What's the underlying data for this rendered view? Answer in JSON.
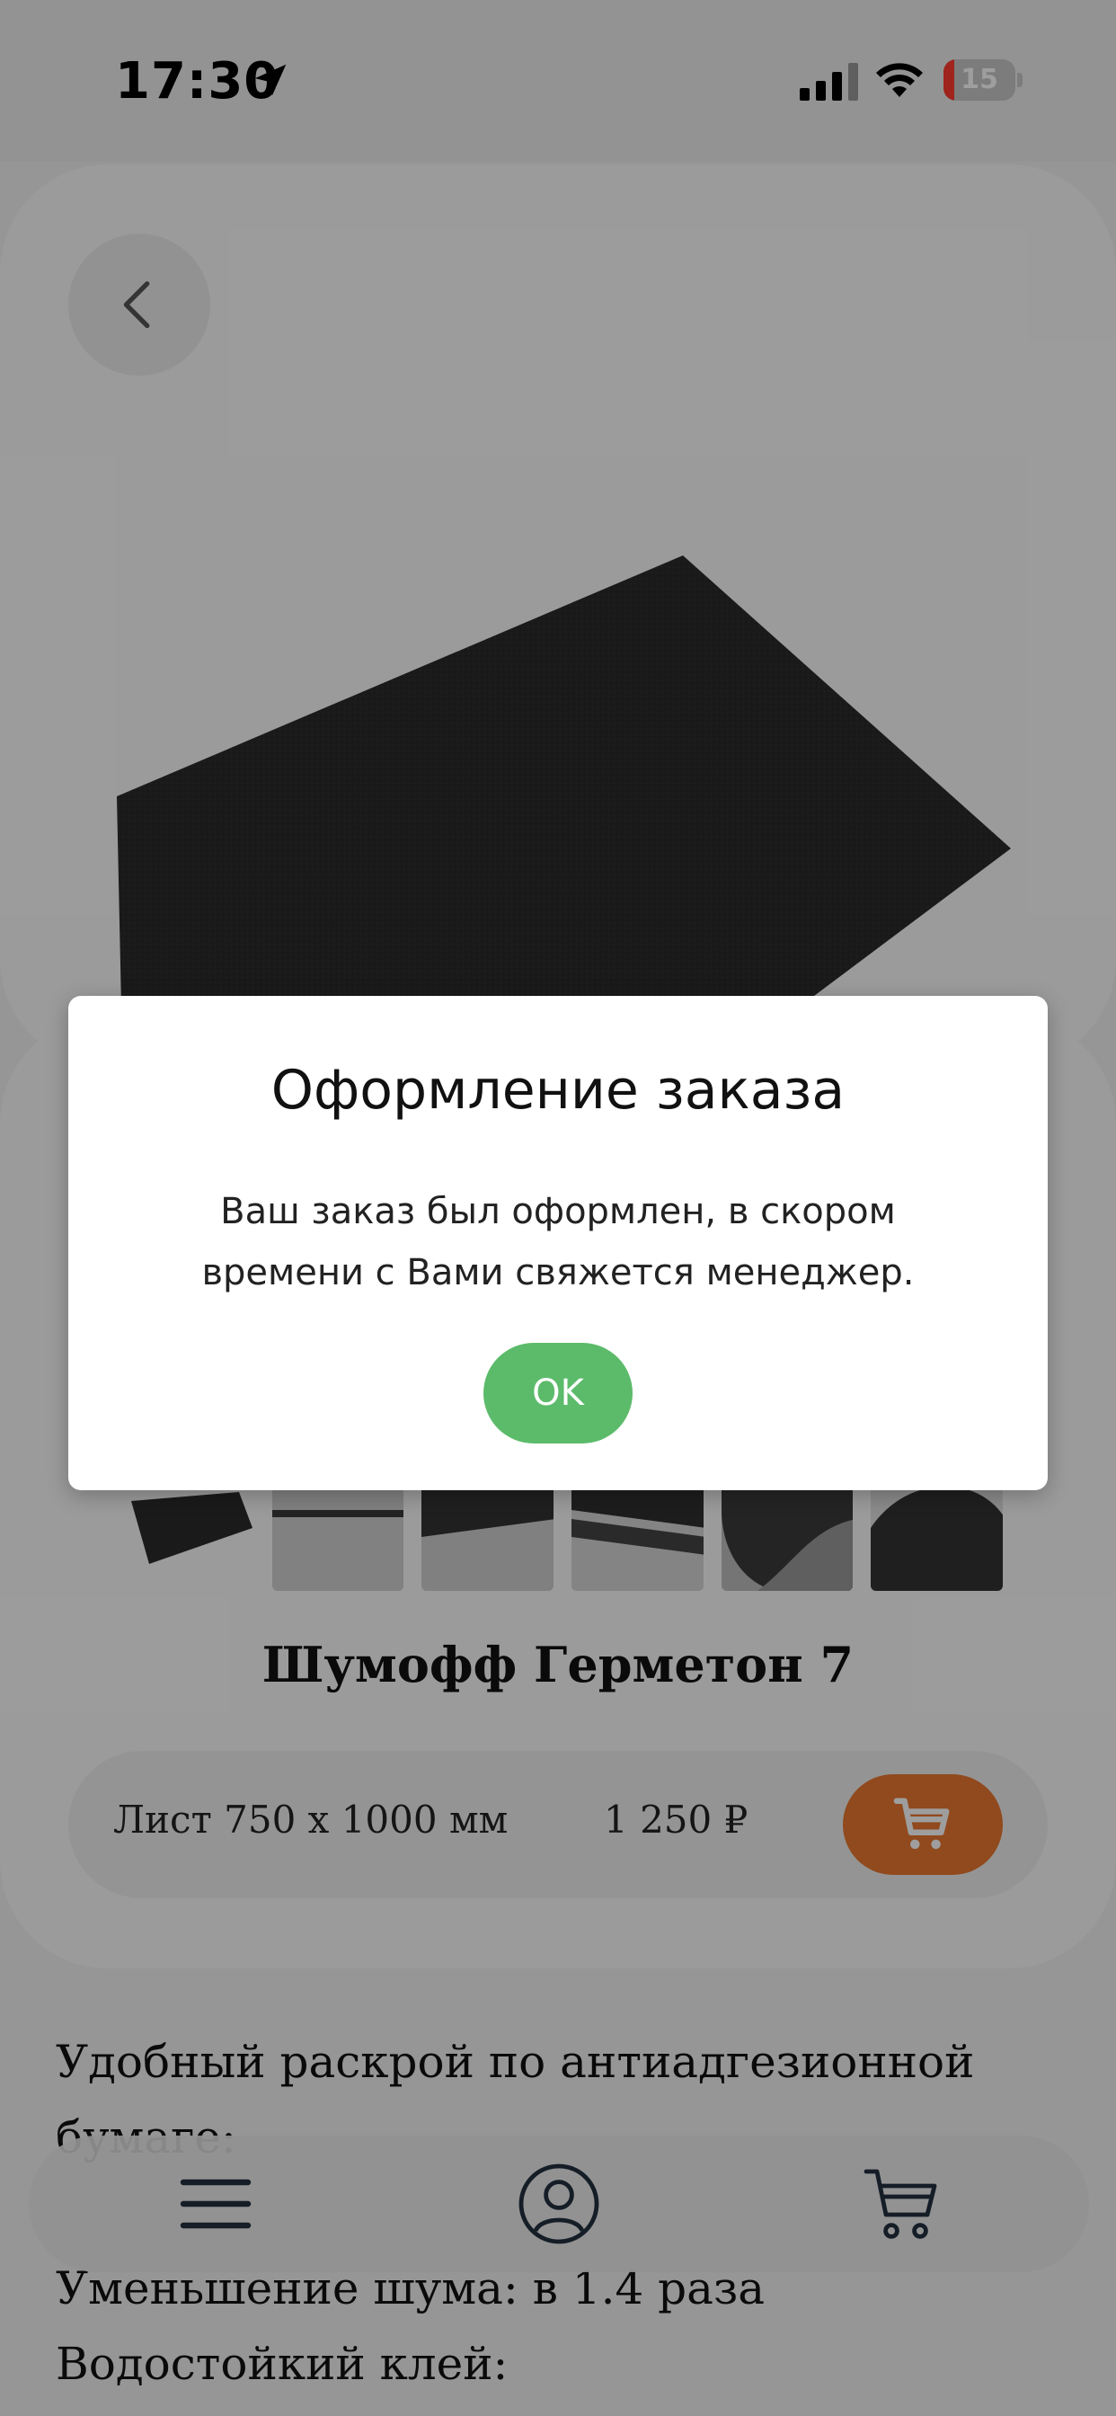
{
  "status_bar": {
    "time": "17:30",
    "battery_level": "15",
    "battery_charging": true
  },
  "product": {
    "title": "Шумофф Герметон 7",
    "image": "black-foam-sheet",
    "thumbnails": [
      "sheet-black",
      "sheet-edge-gray",
      "sheet-corner",
      "sheet-stack",
      "sheet-rolled",
      "sheet-curl"
    ],
    "variant": {
      "name": "Лист 750 x 1000 мм",
      "price": "1 250 ₽"
    },
    "description": [
      "Удобный раскрой по антиадгезионной",
      "бумаге:",
      "Уменьшение шума: в 1.4 раза",
      "Водостойкий клей:"
    ]
  },
  "bottom_nav": {
    "items": [
      "menu-icon",
      "profile-icon",
      "cart-icon"
    ]
  },
  "modal": {
    "title": "Оформление заказа",
    "message_line1": "Ваш заказ был оформлен, в скором",
    "message_line2": "времени с Вами свяжется менеджер.",
    "ok_label": "OK"
  },
  "colors": {
    "accent_orange": "#e8782f",
    "ok_green": "#5cbb6a",
    "overlay": "rgba(0,0,0,0.38)"
  }
}
